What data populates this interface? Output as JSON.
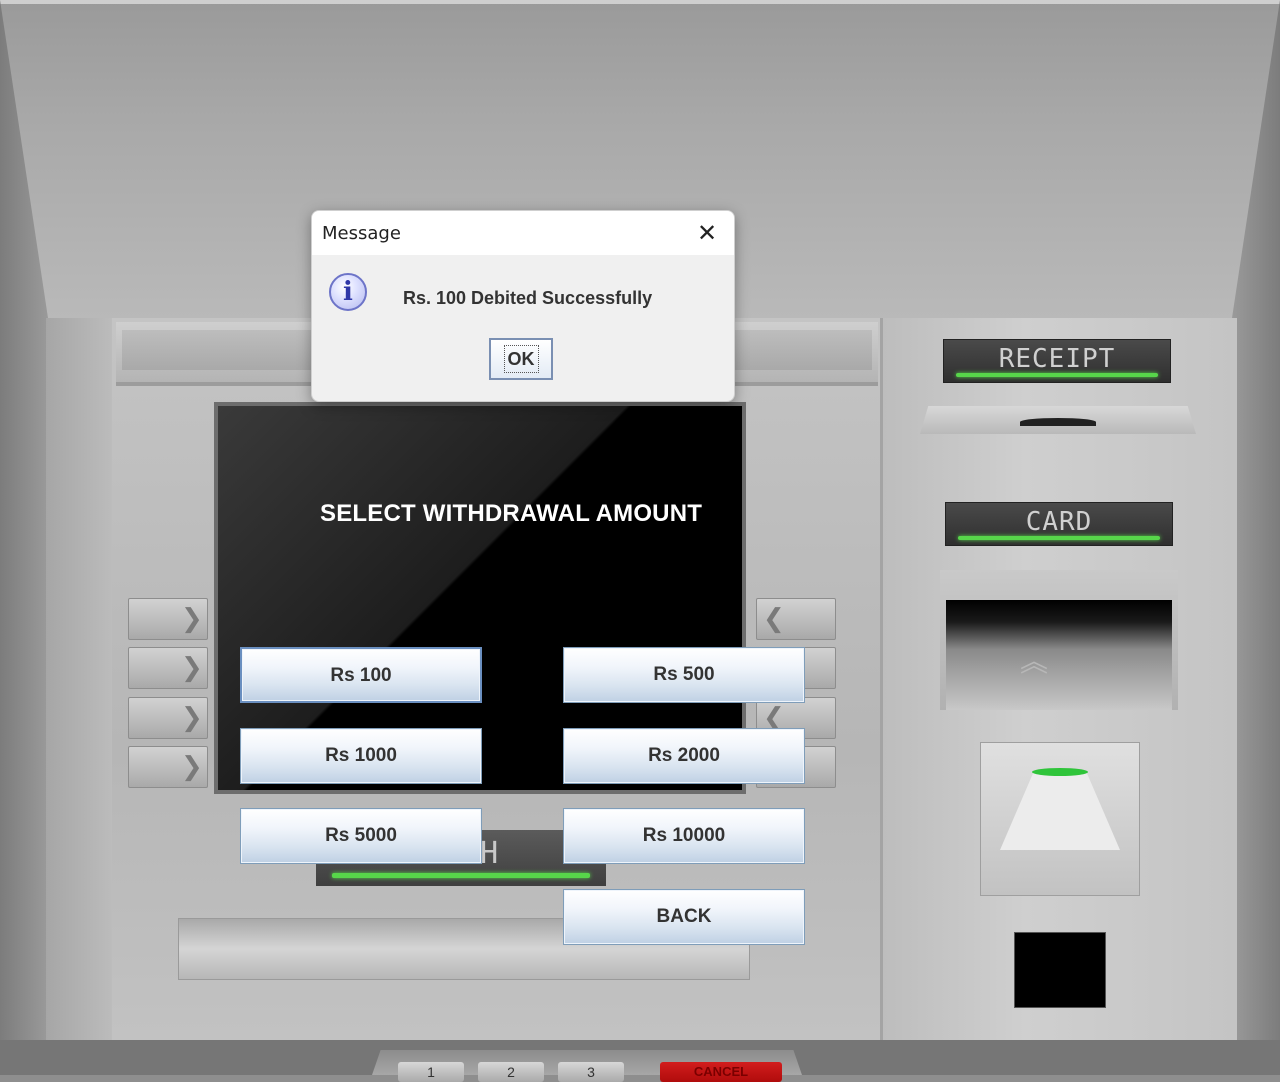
{
  "dialog": {
    "title": "Message",
    "close_icon": "close-icon",
    "info_icon_glyph": "i",
    "message": "Rs. 100 Debited Successfully",
    "ok_label": "OK"
  },
  "screen": {
    "title": "SELECT WITHDRAWAL AMOUNT"
  },
  "amount_buttons": [
    {
      "label": "Rs 100"
    },
    {
      "label": "Rs 500"
    },
    {
      "label": "Rs 1000"
    },
    {
      "label": "Rs 2000"
    },
    {
      "label": "Rs 5000"
    },
    {
      "label": "Rs 10000"
    },
    {
      "label": "BACK"
    }
  ],
  "atm": {
    "receipt_label": "RECEIPT",
    "card_label": "CARD",
    "cash_label": "CASH",
    "keypad": [
      "1",
      "2",
      "3"
    ],
    "cancel_label": "CANCEL"
  },
  "colors": {
    "led_green": "#57d64a",
    "button_border": "#7f9db9",
    "cancel_red": "#c41414"
  }
}
